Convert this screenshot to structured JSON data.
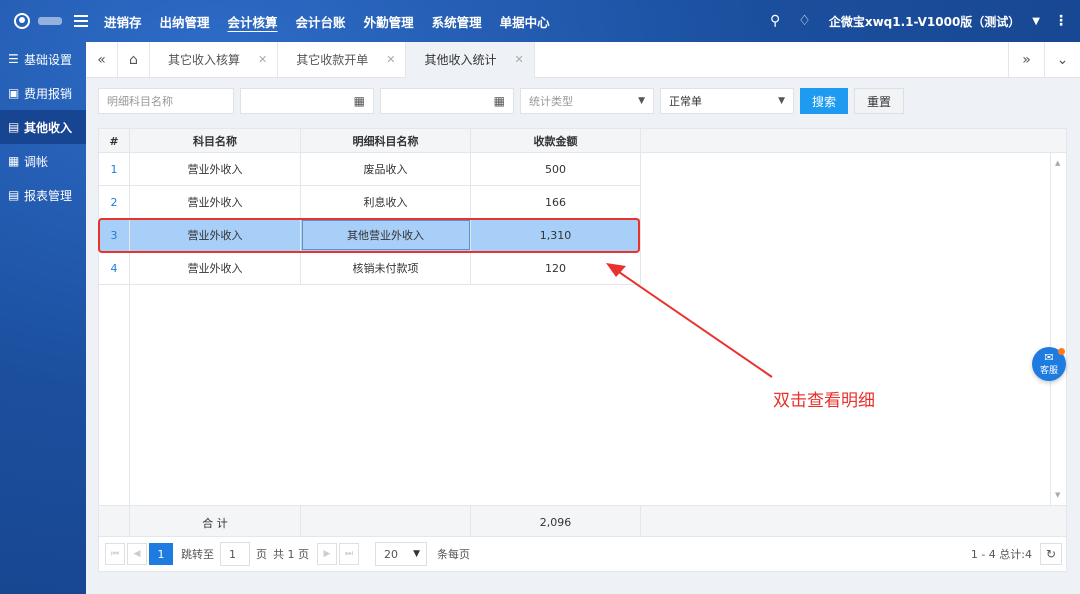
{
  "topbar": {
    "nav": [
      "进销存",
      "出纳管理",
      "会计核算",
      "会计台账",
      "外勤管理",
      "系统管理",
      "单据中心"
    ],
    "account": "企微宝xwq1.1-V1000版（测试）"
  },
  "sidebar": {
    "items": [
      "基础设置",
      "费用报销",
      "其他收入",
      "调帐",
      "报表管理"
    ]
  },
  "tabs": [
    "其它收入核算",
    "其它收款开单",
    "其他收入统计"
  ],
  "filters": {
    "detail_placeholder": "明细科目名称",
    "stat_type_placeholder": "统计类型",
    "doc_type_value": "正常单",
    "search_label": "搜索",
    "reset_label": "重置"
  },
  "grid": {
    "headers": [
      "#",
      "科目名称",
      "明细科目名称",
      "收款金额"
    ],
    "rows": [
      {
        "idx": "1",
        "subject": "营业外收入",
        "detail": "废品收入",
        "amount": "500"
      },
      {
        "idx": "2",
        "subject": "营业外收入",
        "detail": "利息收入",
        "amount": "166"
      },
      {
        "idx": "3",
        "subject": "营业外收入",
        "detail": "其他营业外收入",
        "amount": "1,310"
      },
      {
        "idx": "4",
        "subject": "营业外收入",
        "detail": "核销未付款项",
        "amount": "120"
      }
    ],
    "total_label": "合 计",
    "total_amount": "2,096"
  },
  "pager": {
    "current_page": "1",
    "goto_label": "跳转至",
    "goto_value": "1",
    "page_unit": "页",
    "total_pages": "共 1 页",
    "page_size": "20",
    "per_page_label": "条每页",
    "range_text": "1 - 4 总计:4"
  },
  "annotation": {
    "text": "双击查看明细",
    "color": "#e8322e"
  },
  "support_label": "客服",
  "colors": {
    "accent": "#1e9bf0",
    "selected_row": "#a8cff7"
  }
}
